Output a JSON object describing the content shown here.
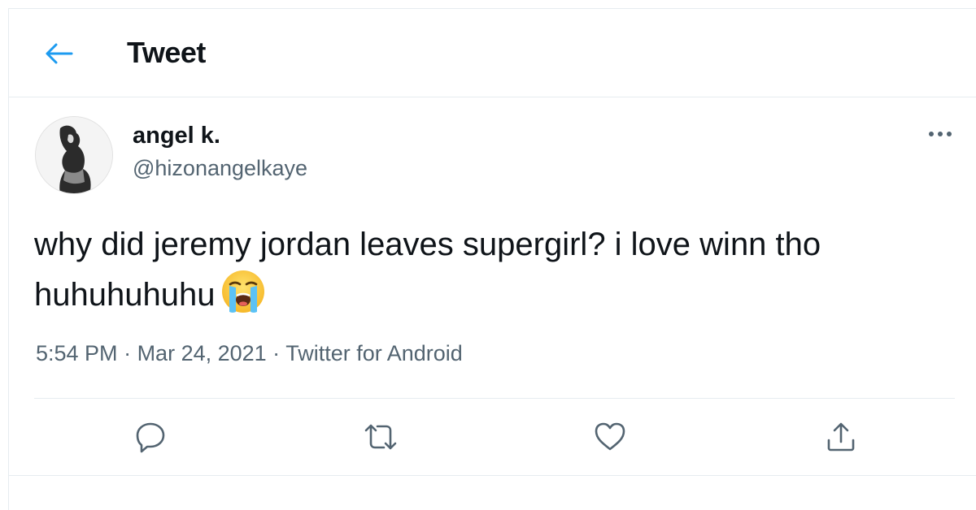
{
  "header": {
    "back_icon": "arrow-left-icon",
    "title": "Tweet"
  },
  "colors": {
    "accent": "#1d9bf0",
    "text_primary": "#0f1419",
    "text_secondary": "#536471",
    "divider": "#e6ecf0"
  },
  "tweet": {
    "author": {
      "display_name": "angel k.",
      "handle": "@hizonangelkaye",
      "avatar_icon": "profile-photo"
    },
    "more_icon": "more-horizontal-icon",
    "text": "why did jeremy jordan leaves supergirl? i love winn tho huhuhuhuhu",
    "emoji": "loudly-crying-face",
    "meta": {
      "time": "5:54 PM",
      "separator": " · ",
      "date": "Mar 24, 2021",
      "source": "Twitter for Android"
    },
    "actions": [
      {
        "name": "reply",
        "icon": "reply-icon"
      },
      {
        "name": "retweet",
        "icon": "retweet-icon"
      },
      {
        "name": "like",
        "icon": "heart-icon"
      },
      {
        "name": "share",
        "icon": "share-icon"
      }
    ]
  }
}
